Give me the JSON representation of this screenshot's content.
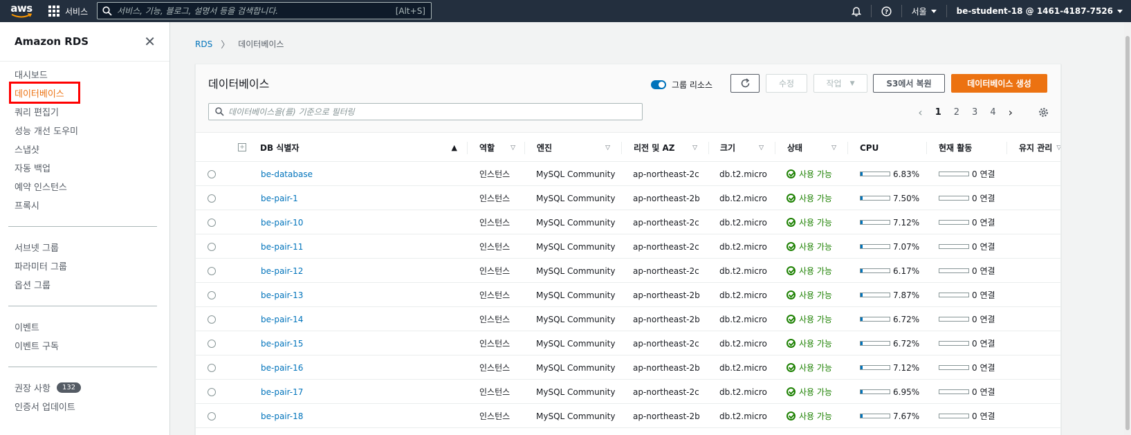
{
  "topnav": {
    "logo_text": "aws",
    "services_label": "서비스",
    "search_placeholder": "서비스, 기능, 블로그, 설명서 등을 검색합니다.",
    "search_shortcut": "[Alt+S]",
    "region": "서울",
    "account": "be-student-18 @ 1461-4187-7526"
  },
  "sidebar": {
    "title": "Amazon RDS",
    "group1": [
      "대시보드",
      "데이터베이스",
      "쿼리 편집기",
      "성능 개선 도우미",
      "스냅샷",
      "자동 백업",
      "예약 인스턴스",
      "프록시"
    ],
    "group2": [
      "서브넷 그룹",
      "파라미터 그룹",
      "옵션 그룹"
    ],
    "group3": [
      "이벤트",
      "이벤트 구독"
    ],
    "group4_item1": "권장 사항",
    "group4_badge": "132",
    "group4_item2": "인증서 업데이트"
  },
  "breadcrumb": {
    "root": "RDS",
    "current": "데이터베이스"
  },
  "panel": {
    "title": "데이터베이스",
    "filter_placeholder": "데이터베이스을(를) 기준으로 필터링",
    "group_toggle_label": "그룹 리소스",
    "modify_label": "수정",
    "actions_label": "작업",
    "restore_label": "S3에서 복원",
    "create_label": "데이터베이스 생성",
    "pages": [
      "1",
      "2",
      "3",
      "4"
    ]
  },
  "table": {
    "headers": [
      "DB 식별자",
      "역할",
      "엔진",
      "리전 및 AZ",
      "크기",
      "상태",
      "CPU",
      "현재 활동",
      "유지 관리"
    ],
    "rows": [
      {
        "id": "be-database",
        "role": "인스턴스",
        "engine": "MySQL Community",
        "az": "ap-northeast-2c",
        "size": "db.t2.micro",
        "status": "사용 가능",
        "cpu": "6.83%",
        "cpu_val": 6.83,
        "activity": "0 연결"
      },
      {
        "id": "be-pair-1",
        "role": "인스턴스",
        "engine": "MySQL Community",
        "az": "ap-northeast-2b",
        "size": "db.t2.micro",
        "status": "사용 가능",
        "cpu": "7.50%",
        "cpu_val": 7.5,
        "activity": "0 연결"
      },
      {
        "id": "be-pair-10",
        "role": "인스턴스",
        "engine": "MySQL Community",
        "az": "ap-northeast-2c",
        "size": "db.t2.micro",
        "status": "사용 가능",
        "cpu": "7.12%",
        "cpu_val": 7.12,
        "activity": "0 연결"
      },
      {
        "id": "be-pair-11",
        "role": "인스턴스",
        "engine": "MySQL Community",
        "az": "ap-northeast-2c",
        "size": "db.t2.micro",
        "status": "사용 가능",
        "cpu": "7.07%",
        "cpu_val": 7.07,
        "activity": "0 연결"
      },
      {
        "id": "be-pair-12",
        "role": "인스턴스",
        "engine": "MySQL Community",
        "az": "ap-northeast-2c",
        "size": "db.t2.micro",
        "status": "사용 가능",
        "cpu": "6.17%",
        "cpu_val": 6.17,
        "activity": "0 연결"
      },
      {
        "id": "be-pair-13",
        "role": "인스턴스",
        "engine": "MySQL Community",
        "az": "ap-northeast-2b",
        "size": "db.t2.micro",
        "status": "사용 가능",
        "cpu": "7.87%",
        "cpu_val": 7.87,
        "activity": "0 연결"
      },
      {
        "id": "be-pair-14",
        "role": "인스턴스",
        "engine": "MySQL Community",
        "az": "ap-northeast-2b",
        "size": "db.t2.micro",
        "status": "사용 가능",
        "cpu": "6.72%",
        "cpu_val": 6.72,
        "activity": "0 연결"
      },
      {
        "id": "be-pair-15",
        "role": "인스턴스",
        "engine": "MySQL Community",
        "az": "ap-northeast-2c",
        "size": "db.t2.micro",
        "status": "사용 가능",
        "cpu": "6.72%",
        "cpu_val": 6.72,
        "activity": "0 연결"
      },
      {
        "id": "be-pair-16",
        "role": "인스턴스",
        "engine": "MySQL Community",
        "az": "ap-northeast-2b",
        "size": "db.t2.micro",
        "status": "사용 가능",
        "cpu": "7.12%",
        "cpu_val": 7.12,
        "activity": "0 연결"
      },
      {
        "id": "be-pair-17",
        "role": "인스턴스",
        "engine": "MySQL Community",
        "az": "ap-northeast-2c",
        "size": "db.t2.micro",
        "status": "사용 가능",
        "cpu": "6.95%",
        "cpu_val": 6.95,
        "activity": "0 연결"
      },
      {
        "id": "be-pair-18",
        "role": "인스턴스",
        "engine": "MySQL Community",
        "az": "ap-northeast-2b",
        "size": "db.t2.micro",
        "status": "사용 가능",
        "cpu": "7.67%",
        "cpu_val": 7.67,
        "activity": "0 연결"
      }
    ]
  },
  "colors": {
    "nav_bg": "#232f3e",
    "accent": "#ec7211",
    "link": "#0073bb",
    "success": "#1d8102"
  }
}
